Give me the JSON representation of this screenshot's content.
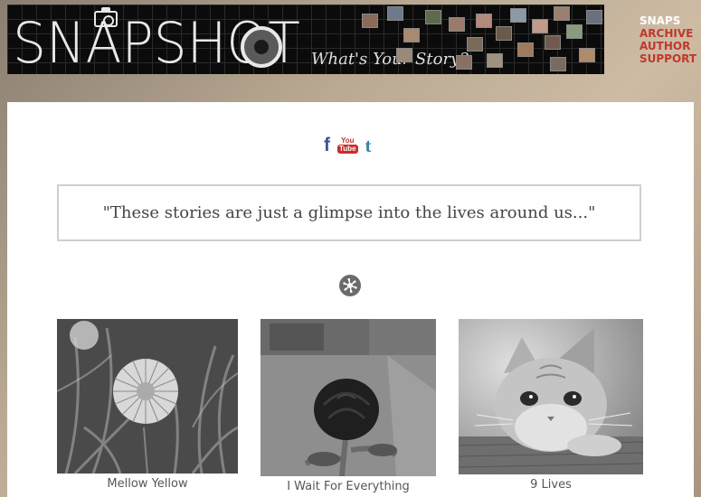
{
  "banner": {
    "logo_text": "SNAPSHOT",
    "tagline": "What's Your Story?"
  },
  "nav": {
    "items": [
      {
        "label": "SNAPS",
        "active": true
      },
      {
        "label": "ARCHIVE",
        "active": false
      },
      {
        "label": "AUTHOR",
        "active": false
      },
      {
        "label": "SUPPORT",
        "active": false
      }
    ]
  },
  "social": {
    "facebook": "f",
    "youtube_top": "You",
    "youtube_bottom": "Tube",
    "tumblr": "t"
  },
  "quote": "\"These stories are just a glimpse into the lives around us...\"",
  "snaps": [
    {
      "caption": "Mellow Yellow"
    },
    {
      "caption": "I Wait For Everything"
    },
    {
      "caption": "9 Lives"
    }
  ],
  "colors": {
    "nav_active": "#ffffff",
    "nav_link": "#c0392b",
    "facebook": "#3b5998",
    "youtube": "#c4302b",
    "tumblr": "#3f7fa6"
  }
}
